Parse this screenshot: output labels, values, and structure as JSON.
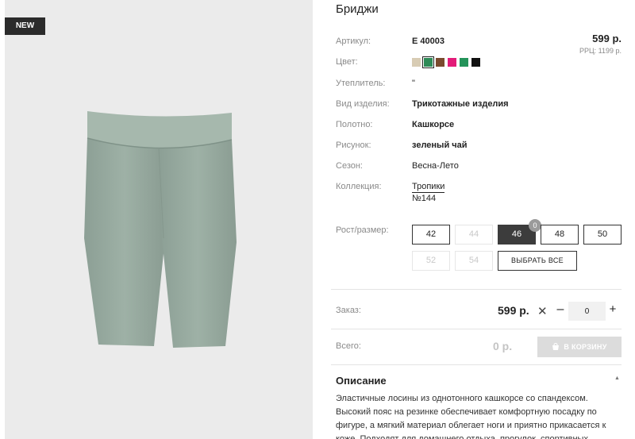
{
  "badge": "NEW",
  "product": {
    "title": "Бриджи",
    "article_label": "Артикул:",
    "article": "E 40003",
    "price": "599 р.",
    "rrp": "РРЦ: 1199 р.",
    "color_label": "Цвет:",
    "swatches": [
      "#d8ccb4",
      "#2e8b57",
      "#7a4a2e",
      "#e31c79",
      "#24935a",
      "#111111"
    ],
    "insulation_label": "Утеплитель:",
    "insulation": "\"",
    "type_label": "Вид изделия:",
    "type": "Трикотажные изделия",
    "fabric_label": "Полотно:",
    "fabric": "Кашкорсе",
    "pattern_label": "Рисунок:",
    "pattern": "зеленый чай",
    "season_label": "Сезон:",
    "season": "Весна-Лето",
    "collection_label": "Коллекция:",
    "collection": "Тропики",
    "collection_no": "№144"
  },
  "sizes": {
    "label": "Рост/размер:",
    "items": [
      "42",
      "44",
      "46",
      "48",
      "50",
      "52",
      "54"
    ],
    "active_count": "0",
    "select_all": "ВЫБРАТЬ ВСЕ"
  },
  "order": {
    "label": "Заказ:",
    "price": "599 р.",
    "times": "✕",
    "minus": "–",
    "qty": "0",
    "plus": "+"
  },
  "total": {
    "label": "Всего:",
    "value": "0 р.",
    "cart_button": "В КОРЗИНУ"
  },
  "description": {
    "heading": "Описание",
    "arrow": "▲",
    "text": "Эластичные лосины из однотонного кашкорсе со спандексом. Высокий пояс на резинке обеспечивает комфортную посадку по фигуре, а мягкий материал облегает ноги и приятно прикасается к коже. Подходят для домашнего отдыха, прогулок, спортивных"
  },
  "icons": {
    "product_image": "shorts-image",
    "cart": "cart-icon"
  }
}
